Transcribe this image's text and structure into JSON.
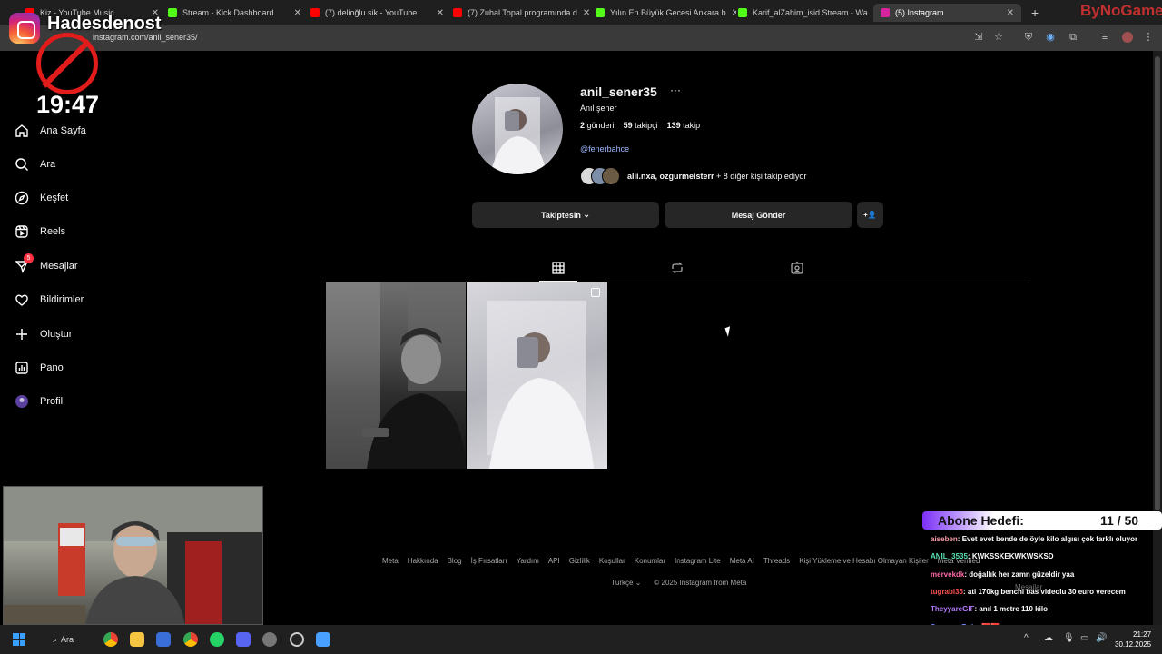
{
  "browser": {
    "tabs": [
      {
        "label": "Kiz - YouTube Music",
        "color": "#ff0000"
      },
      {
        "label": "Stream - Kick Dashboard",
        "color": "#53fc18"
      },
      {
        "label": "(7) delioğlu sik - YouTube",
        "color": "#ff0000"
      },
      {
        "label": "(7) Zuhal Topal programında d",
        "color": "#ff0000"
      },
      {
        "label": "Yılın En Büyük Gecesi Ankara b",
        "color": "#53fc18"
      },
      {
        "label": "Karif_alZahim_isid Stream - Wa",
        "color": "#53fc18"
      },
      {
        "label": "(5) Instagram",
        "color": "#d6249f"
      }
    ],
    "url": "instagram.com/anil_sener35/"
  },
  "overlay": {
    "streamer_name": "Hadesdenost",
    "brand": "ByNoGame",
    "clock": "19:47"
  },
  "sidebar": {
    "items": [
      {
        "label": "Ana Sayfa",
        "icon": "home-icon"
      },
      {
        "label": "Ara",
        "icon": "search-icon"
      },
      {
        "label": "Keşfet",
        "icon": "compass-icon"
      },
      {
        "label": "Reels",
        "icon": "reels-icon"
      },
      {
        "label": "Mesajlar",
        "icon": "messenger-icon",
        "badge": "5"
      },
      {
        "label": "Bildirimler",
        "icon": "heart-icon"
      },
      {
        "label": "Oluştur",
        "icon": "plus-icon"
      },
      {
        "label": "Pano",
        "icon": "dashboard-icon"
      },
      {
        "label": "Profil",
        "icon": "profile-avatar-icon"
      }
    ]
  },
  "profile": {
    "username": "anil_sener35",
    "more": "···",
    "full_name": "Anıl şener",
    "posts_count": "2",
    "posts_label": "gönderi",
    "followers_count": "59",
    "followers_label": "takipçi",
    "following_count": "139",
    "following_label": "takip",
    "bio_link": "@fenerbahce",
    "followed_by_names": "alii.nxa, ozgurmeisterr",
    "followed_by_rest": " + 8 diğer kişi takip ediyor",
    "follow_button": "Takiptesin",
    "message_button": "Mesaj Gönder",
    "add_person_icon": "+👤"
  },
  "tabs": [
    {
      "name": "posts-grid-tab",
      "icon": "grid-icon",
      "active": true
    },
    {
      "name": "reposts-tab",
      "icon": "repost-icon",
      "active": false
    },
    {
      "name": "tagged-tab",
      "icon": "tagged-icon",
      "active": false
    }
  ],
  "footer": {
    "links": [
      "Meta",
      "Hakkında",
      "Blog",
      "İş Fırsatları",
      "Yardım",
      "API",
      "Gizlilik",
      "Koşullar",
      "Konumlar",
      "Instagram Lite",
      "Meta AI",
      "Threads",
      "Kişi Yükleme ve Hesabı Olmayan Kişiler",
      "Meta Verified"
    ],
    "language": "Türkçe",
    "copyright": "© 2025 Instagram from Meta"
  },
  "stream_overlay": {
    "goal_label": "Abone Hedefi:",
    "goal_count": "11 / 50",
    "chat": [
      {
        "user": "aiseben",
        "user_color": "#ff9aa8",
        "text": "Evet evet bende de öyle kilo algısı çok farklı oluyor"
      },
      {
        "user": "ANIL_3535",
        "user_color": "#58e0b0",
        "text": "KWKSSKEKWKWSKSD"
      },
      {
        "user": "mervekdk",
        "user_color": "#ff6aa8",
        "text": "doğallık her zamn güzeldir yaa"
      },
      {
        "user": "tugrabi35",
        "user_color": "#ff4f4f",
        "text": "ati 170kg benchi bas videolu 30 euro verecem"
      },
      {
        "user": "TheyyareGIF",
        "user_color": "#b57bff",
        "text": "anıl 1 metre 110 kilo"
      },
      {
        "user": "SupremeBolz",
        "user_color": "#6f8cff",
        "text": "🟥🟥"
      }
    ],
    "messages_popup": "Mesajlar"
  },
  "taskbar": {
    "search_label": "Ara",
    "time": "21:27",
    "date": "30.12.2025"
  }
}
